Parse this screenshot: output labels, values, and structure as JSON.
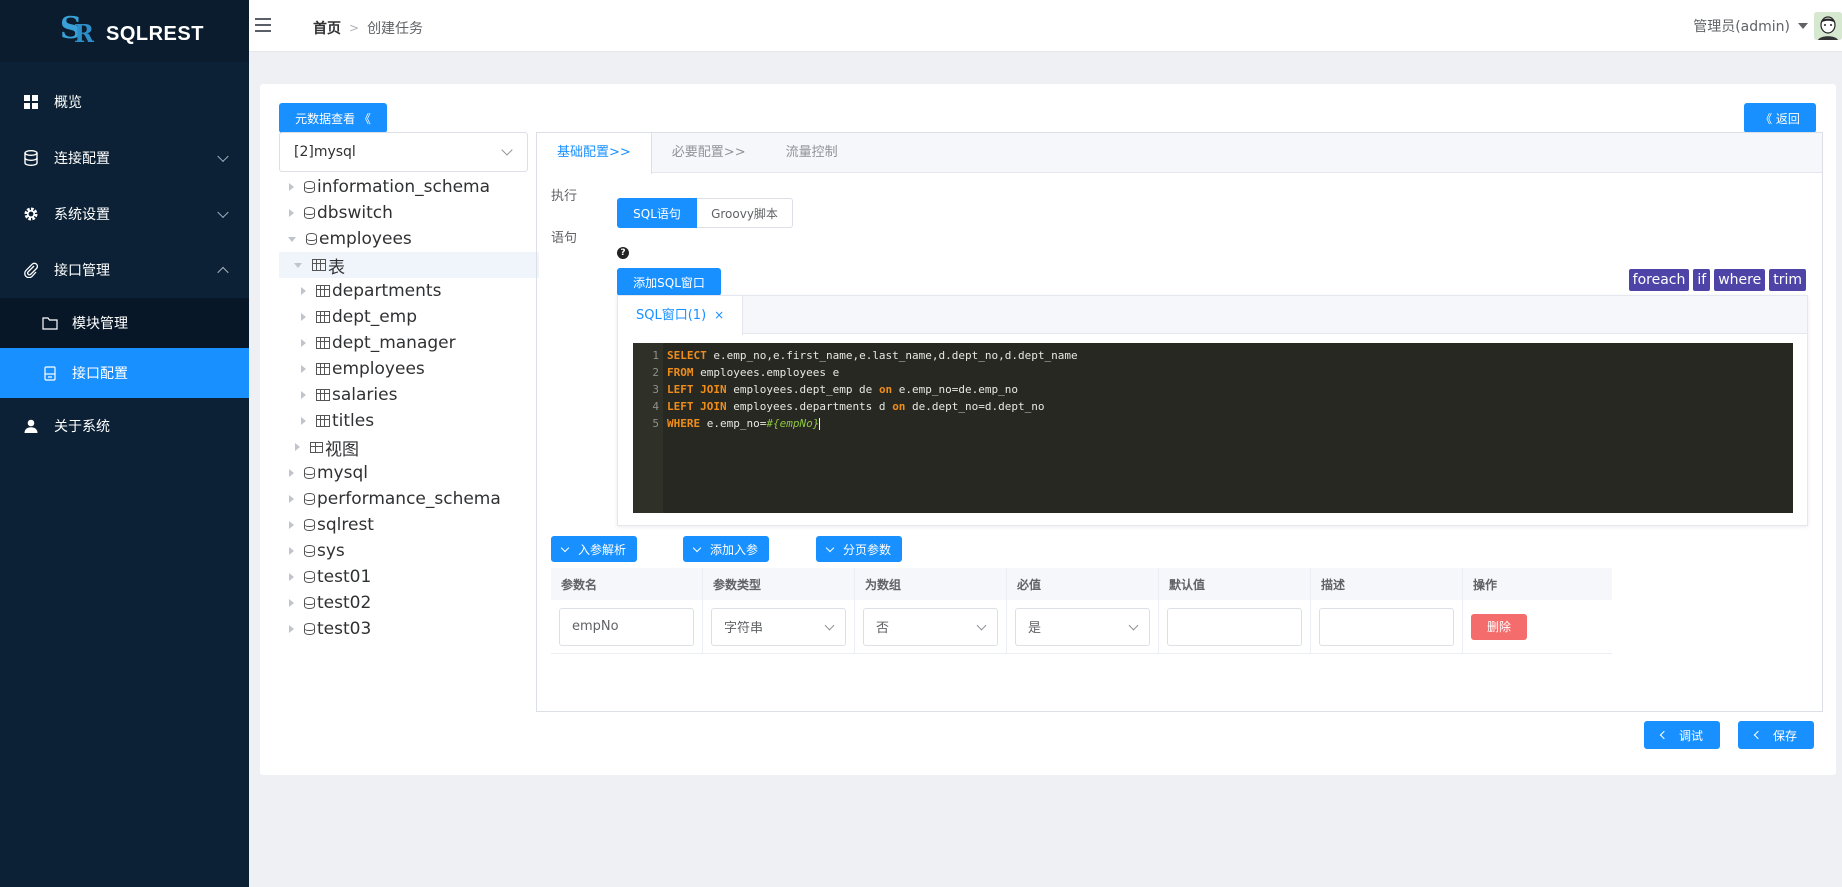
{
  "app": {
    "logo_text": "SQLREST"
  },
  "sidebar": {
    "items": [
      {
        "label": "概览",
        "icon": "dashboard-icon"
      },
      {
        "label": "连接配置",
        "icon": "database-icon"
      },
      {
        "label": "系统设置",
        "icon": "gear-icon"
      },
      {
        "label": "接口管理",
        "icon": "paperclip-icon"
      },
      {
        "label": "关于系统",
        "icon": "user-icon"
      }
    ],
    "sub_items": [
      {
        "label": "模块管理",
        "icon": "folder-icon"
      },
      {
        "label": "接口配置",
        "icon": "document-icon"
      }
    ]
  },
  "header": {
    "breadcrumb_home": "首页",
    "breadcrumb_sep": ">",
    "breadcrumb_current": "创建任务",
    "user": "管理员(admin)"
  },
  "toolbar": {
    "meta_button": "元数据查看 《",
    "back_button": "《 返回"
  },
  "db_select": {
    "value": "[2]mysql"
  },
  "tree": {
    "nodes": [
      {
        "label": "information_schema"
      },
      {
        "label": "dbswitch"
      },
      {
        "label": "employees"
      },
      {
        "label": "表"
      },
      {
        "label": "departments"
      },
      {
        "label": "dept_emp"
      },
      {
        "label": "dept_manager"
      },
      {
        "label": "employees"
      },
      {
        "label": "salaries"
      },
      {
        "label": "titles"
      },
      {
        "label": "视图"
      },
      {
        "label": "mysql"
      },
      {
        "label": "performance_schema"
      },
      {
        "label": "sqlrest"
      },
      {
        "label": "sys"
      },
      {
        "label": "test01"
      },
      {
        "label": "test02"
      },
      {
        "label": "test03"
      }
    ]
  },
  "panel": {
    "tabs": [
      "基础配置>>",
      "必要配置>>",
      "流量控制"
    ],
    "exec_label": "执行",
    "exec_options": [
      "SQL语句",
      "Groovy脚本"
    ],
    "stmt_label": "语句",
    "help": "?",
    "add_sql_button": "添加SQL窗口",
    "tags": [
      "foreach",
      "if",
      "where",
      "trim"
    ],
    "sql_tab": "SQL窗口(1)",
    "sql_tab_close": "×"
  },
  "sql": {
    "ln": [
      "1",
      "2",
      "3",
      "4",
      "5"
    ],
    "l1_kw": "SELECT",
    "l1_rest": " e.emp_no,e.first_name,e.last_name,d.dept_no,d.dept_name",
    "l2_kw": "FROM",
    "l2_rest": " employees.employees e",
    "l3_kw": "LEFT JOIN",
    "l3_a": " employees.dept_emp de ",
    "l3_on": "on",
    "l3_b": " e.emp_no=de.emp_no",
    "l4_kw": "LEFT JOIN",
    "l4_a": " employees.departments d ",
    "l4_on": "on",
    "l4_b": " de.dept_no=d.dept_no",
    "l5_kw": "WHERE",
    "l5_a": " e.emp_no=",
    "l5_param": "#{empNo}"
  },
  "params": {
    "buttons": [
      "入参解析",
      "添加入参",
      "分页参数"
    ],
    "headers": [
      "参数名",
      "参数类型",
      "为数组",
      "必值",
      "默认值",
      "描述",
      "操作"
    ],
    "row": {
      "name": "empNo",
      "type": "字符串",
      "is_array": "否",
      "required": "是",
      "default": "",
      "desc": "",
      "delete": "删除"
    }
  },
  "footer": {
    "debug_button": "调试",
    "save_button": "保存"
  },
  "colors": {
    "primary": "#1890ff",
    "sidebar": "#0c2135",
    "danger": "#f56c6c",
    "tag": "#4e44a8",
    "editor_bg": "#272822"
  }
}
